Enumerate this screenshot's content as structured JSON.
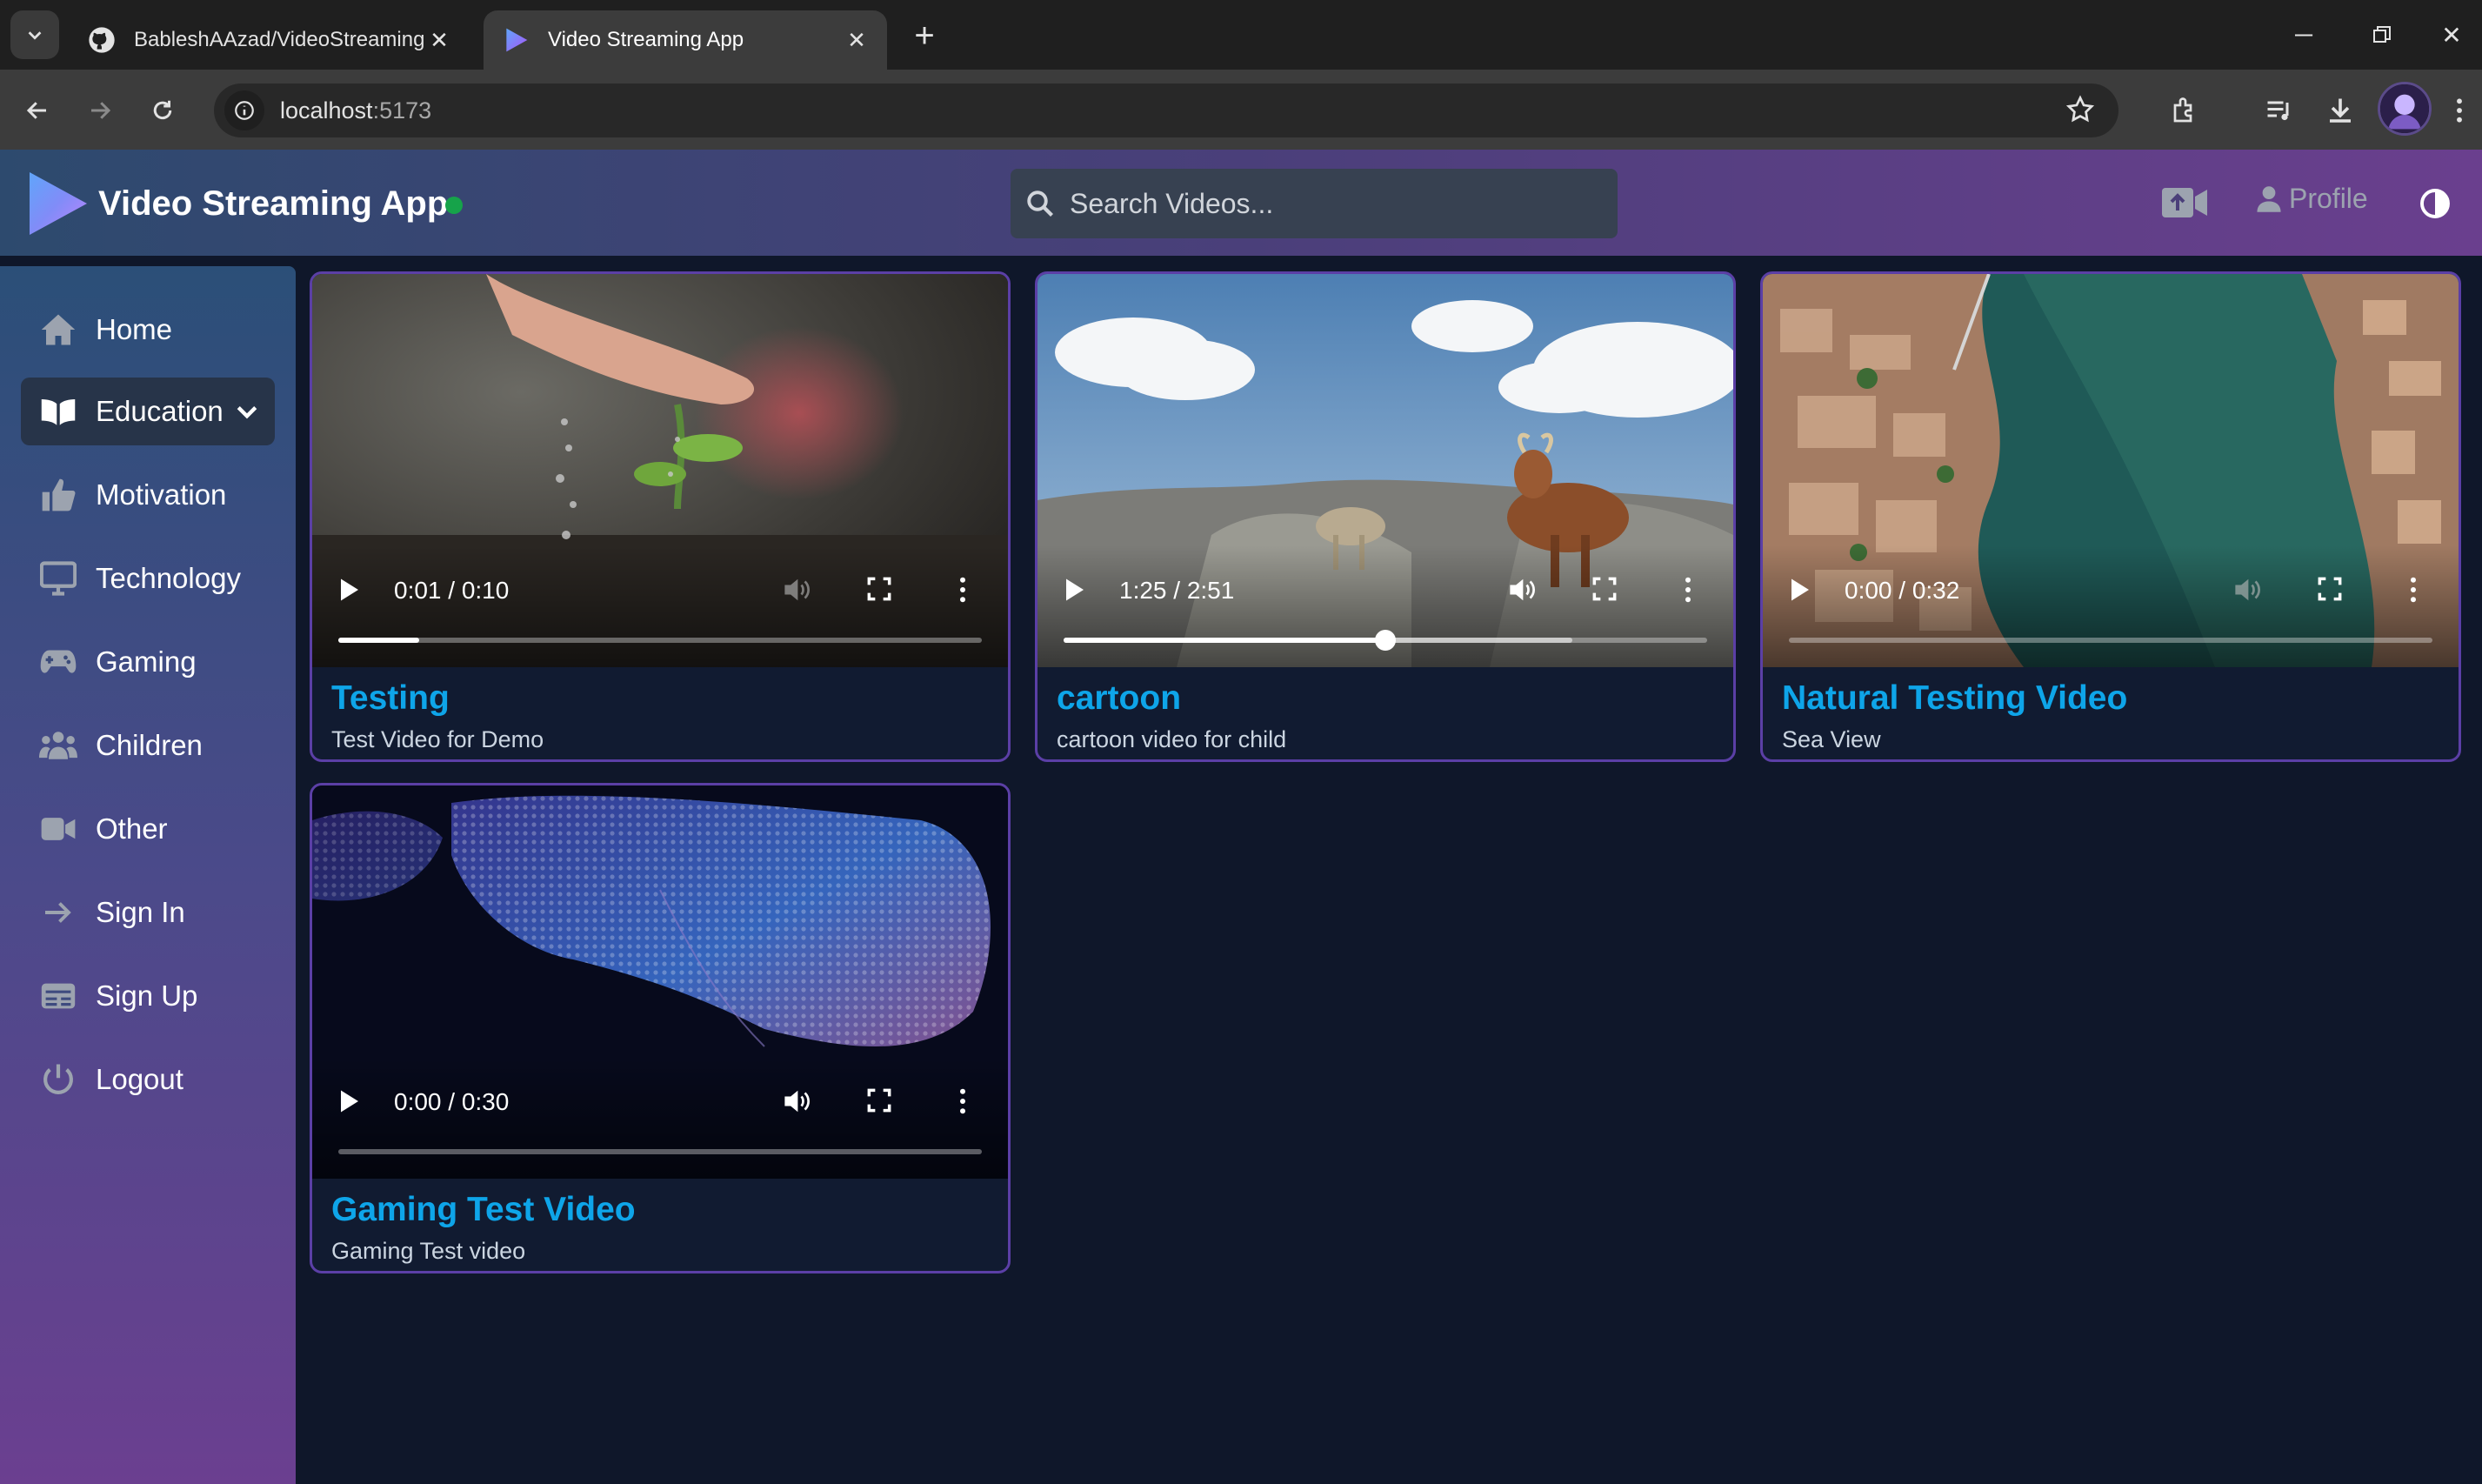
{
  "browser": {
    "tabs": [
      {
        "title": "BableshAAzad/VideoStreaming",
        "icon": "github-icon"
      },
      {
        "title": "Video Streaming App",
        "icon": "app-logo-icon"
      }
    ],
    "url_host": "localhost",
    "url_port": ":5173"
  },
  "header": {
    "app_title": "Video Streaming App",
    "search_placeholder": "Search Videos...",
    "profile_label": "Profile"
  },
  "sidebar": {
    "items": [
      {
        "label": "Home",
        "icon": "home-icon"
      },
      {
        "label": "Education",
        "icon": "book-icon",
        "active": true
      },
      {
        "label": "Motivation",
        "icon": "thumbs-up-icon"
      },
      {
        "label": "Technology",
        "icon": "monitor-icon"
      },
      {
        "label": "Gaming",
        "icon": "gamepad-icon"
      },
      {
        "label": "Children",
        "icon": "users-icon"
      },
      {
        "label": "Other",
        "icon": "video-camera-icon"
      },
      {
        "label": "Sign In",
        "icon": "arrow-right-icon"
      },
      {
        "label": "Sign Up",
        "icon": "id-card-icon"
      },
      {
        "label": "Logout",
        "icon": "power-icon"
      }
    ]
  },
  "videos": [
    {
      "title": "Testing",
      "description": "Test Video for Demo",
      "time": "0:01 / 0:10",
      "progress": 0.125,
      "volume_muted": true
    },
    {
      "title": "cartoon",
      "description": "cartoon video for child",
      "time": "1:25 / 2:51",
      "progress": 0.5,
      "buffered": 0.79,
      "volume_muted": false
    },
    {
      "title": "Natural Testing Video",
      "description": "Sea View",
      "time": "0:00 / 0:32",
      "progress": 0.0,
      "volume_muted": true
    },
    {
      "title": "Gaming Test Video",
      "description": "Gaming Test video",
      "time": "0:00 / 0:30",
      "progress": 0.0,
      "volume_muted": false
    }
  ],
  "colors": {
    "accent": "#0ea5e9",
    "card_border": "#5b3fa6",
    "background": "#0f172a",
    "status_online": "#16a34a"
  }
}
